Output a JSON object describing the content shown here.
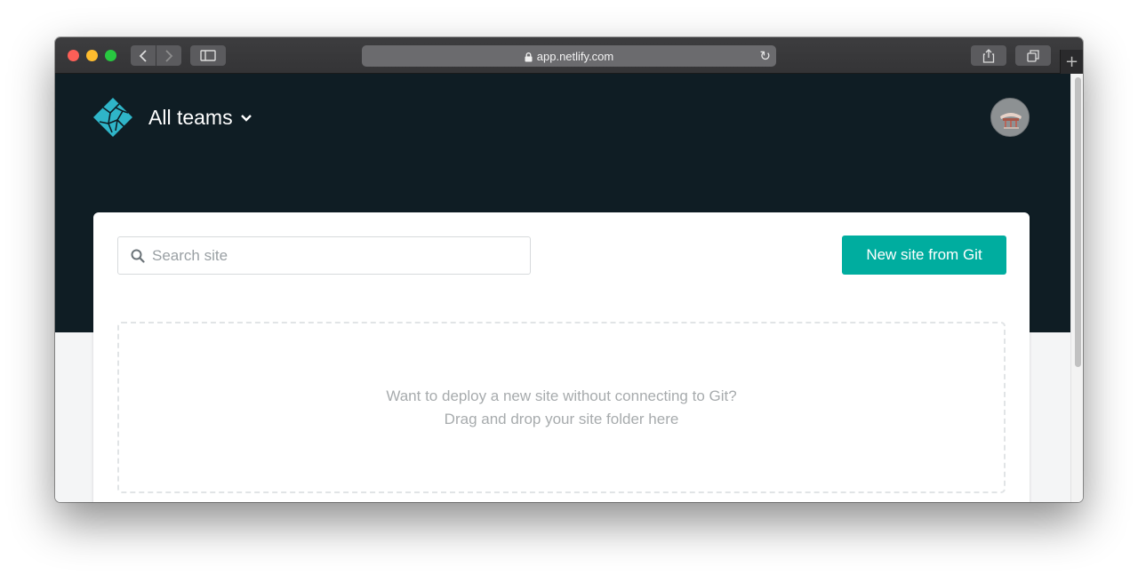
{
  "browser": {
    "url": "app.netlify.com",
    "icons": [
      "back-icon",
      "forward-icon",
      "sidebar-icon",
      "lock-icon",
      "reload-icon",
      "share-icon",
      "tabs-icon",
      "plus-icon"
    ]
  },
  "header": {
    "team_label": "All teams",
    "logo_icon": "netlify-logo-icon",
    "avatar_icon": "user-avatar"
  },
  "main": {
    "search_placeholder": "Search site",
    "new_site_label": "New site from Git",
    "dropzone_line1": "Want to deploy a new site without connecting to Git?",
    "dropzone_line2": "Drag and drop your site folder here"
  },
  "colors": {
    "header_bg": "#0f1d24",
    "accent": "#00ad9f",
    "logo": "#2fb5c8"
  }
}
